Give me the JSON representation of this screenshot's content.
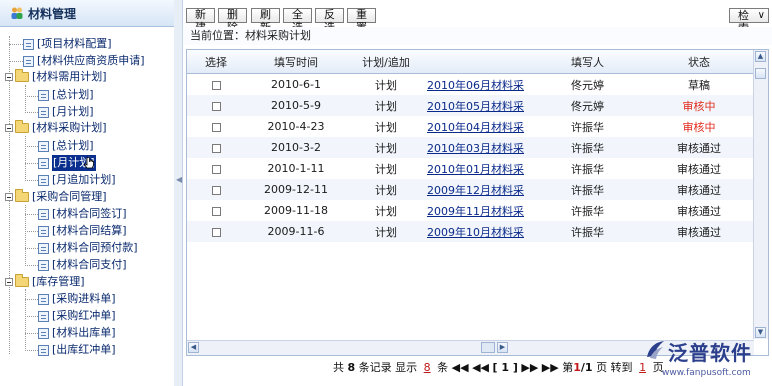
{
  "sidebar": {
    "title": "材料管理",
    "items": [
      {
        "label": "[项目材料配置]"
      },
      {
        "label": "[材料供应商资质申请]"
      },
      {
        "label": "[材料需用计划]"
      },
      {
        "label": "[总计划]"
      },
      {
        "label": "[月计划]"
      },
      {
        "label": "[材料采购计划]"
      },
      {
        "label": "[总计划]"
      },
      {
        "label": "[月计划]",
        "selected": true
      },
      {
        "label": "[月追加计划]"
      },
      {
        "label": "[采购合同管理]"
      },
      {
        "label": "[材料合同签订]"
      },
      {
        "label": "[材料合同结算]"
      },
      {
        "label": "[材料合同预付款]"
      },
      {
        "label": "[材料合同支付]"
      },
      {
        "label": "[库存管理]"
      },
      {
        "label": "[采购进料单]"
      },
      {
        "label": "[采购红冲单]"
      },
      {
        "label": "[材料出库单]"
      },
      {
        "label": "[出库红冲单]"
      }
    ]
  },
  "toolbar": {
    "new": "新建",
    "delete": "删除",
    "refresh": "刷新",
    "select_all": "全选",
    "invert": "反选",
    "reset": "重置",
    "search": "检索"
  },
  "location": "当前位置：材料采购计划",
  "table": {
    "headers": {
      "select": "选择",
      "date": "填写时间",
      "type": "计划/追加",
      "name": "",
      "filler": "填写人",
      "status": "状态"
    },
    "rows": [
      {
        "date": "2010-6-1",
        "type": "计划",
        "name": "2010年06月材料采",
        "filler": "佟元婷",
        "status": "草稿",
        "status_color": "#1a1a1a"
      },
      {
        "date": "2010-5-9",
        "type": "计划",
        "name": "2010年05月材料采",
        "filler": "佟元婷",
        "status": "审核中",
        "status_color": "#e02a1c"
      },
      {
        "date": "2010-4-23",
        "type": "计划",
        "name": "2010年04月材料采",
        "filler": "许振华",
        "status": "审核中",
        "status_color": "#e02a1c"
      },
      {
        "date": "2010-3-2",
        "type": "计划",
        "name": "2010年03月材料采",
        "filler": "许振华",
        "status": "审核通过",
        "status_color": "#1a1a1a"
      },
      {
        "date": "2010-1-11",
        "type": "计划",
        "name": "2010年01月材料采",
        "filler": "许振华",
        "status": "审核通过",
        "status_color": "#1a1a1a"
      },
      {
        "date": "2009-12-11",
        "type": "计划",
        "name": "2009年12月材料采",
        "filler": "许振华",
        "status": "审核通过",
        "status_color": "#1a1a1a"
      },
      {
        "date": "2009-11-18",
        "type": "计划",
        "name": "2009年11月材料采",
        "filler": "许振华",
        "status": "审核通过",
        "status_color": "#1a1a1a"
      },
      {
        "date": "2009-11-6",
        "type": "计划",
        "name": "2009年10月材料采",
        "filler": "许振华",
        "status": "审核通过",
        "status_color": "#1a1a1a"
      }
    ]
  },
  "pager": {
    "prefix": "共",
    "total": "8",
    "records_show": "条记录 显示",
    "per_page": "8",
    "items_nav": "条",
    "current_page_bracket": "[ 1 ]",
    "page_prefix": "第",
    "page_current": "1",
    "page_sep": "/",
    "page_total": "1",
    "page_suffix": "页 转到",
    "goto": "1",
    "goto_suffix": "页"
  },
  "brand": {
    "name": "泛普软件",
    "url": "www.fanpusoft.com"
  },
  "colors": {
    "status_red": "#e02a1c",
    "link_blue": "#0a2a8a",
    "selected_bg": "#0b2f8f",
    "brand_blue": "#2c3f8c"
  }
}
